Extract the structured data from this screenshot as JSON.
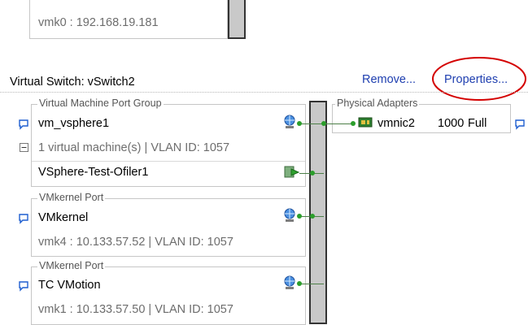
{
  "top": {
    "vmk0_text": "vmk0 : 192.168.19.181"
  },
  "vswitch": {
    "title": "Virtual Switch: vSwitch2",
    "remove_label": "Remove...",
    "properties_label": "Properties..."
  },
  "vm_group": {
    "title": "Virtual Machine Port Group",
    "name": "vm_vsphere1",
    "summary": "1 virtual machine(s) | VLAN ID: 1057",
    "vm_name": "VSphere-Test-Ofiler1"
  },
  "vmk_port_1": {
    "title": "VMkernel Port",
    "name": "VMkernel",
    "detail": "vmk4 : 10.133.57.52 | VLAN ID: 1057"
  },
  "vmk_port_2": {
    "title": "VMkernel Port",
    "name": "TC VMotion",
    "detail": "vmk1 : 10.133.57.50 | VLAN ID: 1057"
  },
  "physical": {
    "title": "Physical Adapters",
    "adapter_name": "vmnic2",
    "speed": "1000",
    "duplex": "Full"
  },
  "colors": {
    "link": "#1f3fb0",
    "annotation_circle": "#d40000",
    "connector": "#2b9e2b"
  }
}
